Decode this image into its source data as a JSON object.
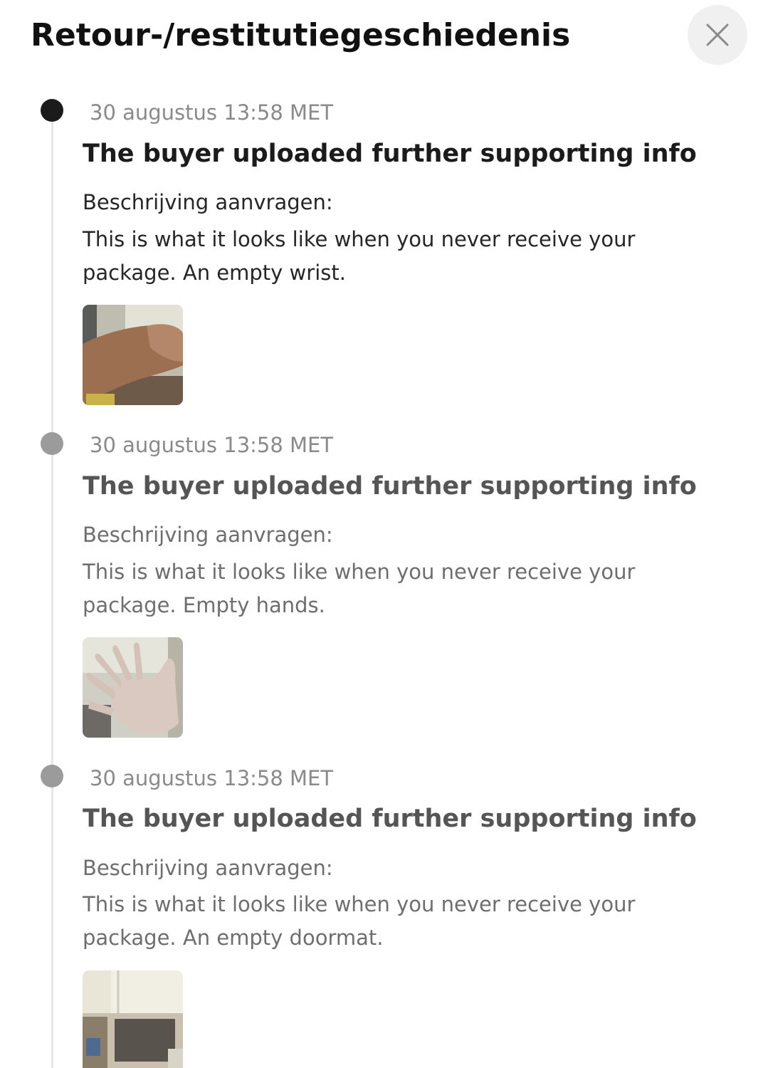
{
  "header": {
    "title": "Retour-/restitutiegeschiedenis",
    "close_icon": "close-icon"
  },
  "timeline": [
    {
      "timestamp": "30 augustus 13:58 MET",
      "title": "The buyer uploaded further supporting info",
      "description_label": "Beschrijving aanvragen:",
      "description": "This is what it looks like when you never receive your package. An empty wrist.",
      "state": "active",
      "attachment_icon": "wrist-photo-thumbnail"
    },
    {
      "timestamp": "30 augustus 13:58 MET",
      "title": "The buyer uploaded further supporting info",
      "description_label": "Beschrijving aanvragen:",
      "description": "This is what it looks like when you never receive your package. Empty hands.",
      "state": "inactive",
      "attachment_icon": "hand-photo-thumbnail"
    },
    {
      "timestamp": "30 augustus 13:58 MET",
      "title": "The buyer uploaded further supporting info",
      "description_label": "Beschrijving aanvragen:",
      "description": "This is what it looks like when you never receive your package. An empty doormat.",
      "state": "inactive",
      "attachment_icon": "doormat-photo-thumbnail"
    }
  ]
}
